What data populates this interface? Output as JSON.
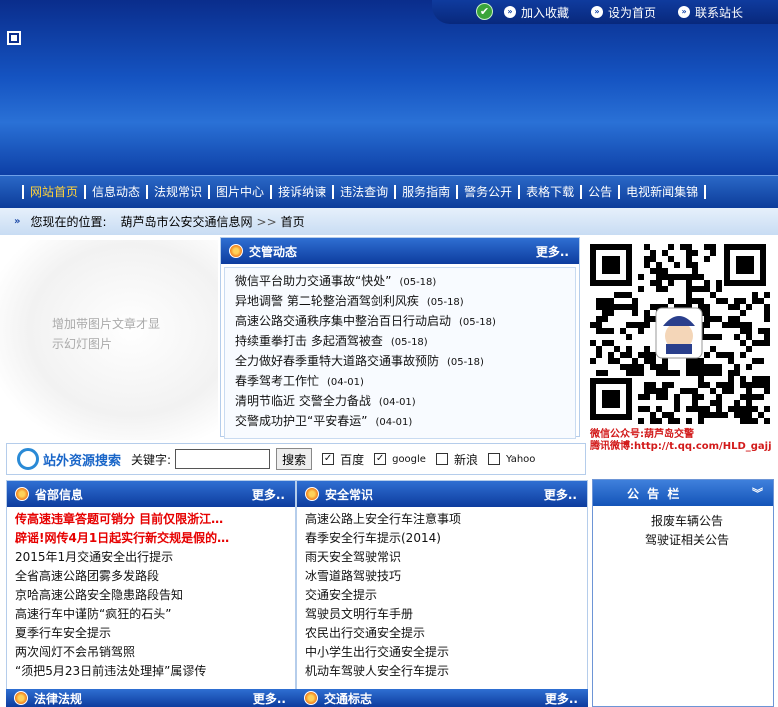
{
  "top_links": {
    "favorite": "加入收藏",
    "homepage": "设为首页",
    "contact": "联系站长"
  },
  "nav": [
    "网站首页",
    "信息动态",
    "法规常识",
    "图片中心",
    "接诉纳谏",
    "违法查询",
    "服务指南",
    "警务公开",
    "表格下载",
    "公告",
    "电视新闻集锦"
  ],
  "breadcrumb": {
    "label": "您现在的位置:",
    "site": "葫芦岛市公安交通信息网",
    "sep": ">>",
    "current": "首页"
  },
  "slideshow": {
    "placeholder": "增加带图片文章才显示幻灯图片"
  },
  "news": {
    "title": "交管动态",
    "more": "更多..",
    "items": [
      {
        "text": "微信平台助力交通事故“快处”",
        "date": "(05-18)"
      },
      {
        "text": "异地调警 第二轮整治酒驾剑利风疾",
        "date": "(05-18)"
      },
      {
        "text": "高速公路交通秩序集中整治百日行动启动",
        "date": "(05-18)"
      },
      {
        "text": "持续重拳打击 多起酒驾被查",
        "date": "(05-18)"
      },
      {
        "text": "全力做好春季重特大道路交通事故预防",
        "date": "(05-18)"
      },
      {
        "text": "春季驾考工作忙",
        "date": "(04-01)"
      },
      {
        "text": "清明节临近 交警全力备战",
        "date": "(04-01)"
      },
      {
        "text": "交警成功护卫“平安春运”",
        "date": "(04-01)"
      }
    ]
  },
  "qr": {
    "wechat": "微信公众号:葫芦岛交警",
    "weibo": "腾讯微博:http://t.qq.com/HLD_gajj"
  },
  "search": {
    "logo": "站外资源搜索",
    "keyword_label": "关键字:",
    "button": "搜索",
    "engines": [
      "百度",
      "google",
      "新浪",
      "Yahoo"
    ],
    "checked": [
      true,
      true,
      false,
      false
    ]
  },
  "province": {
    "title": "省部信息",
    "more": "更多..",
    "items": [
      {
        "text": "传高速违章答题可销分 目前仅限浙江…",
        "hot": true
      },
      {
        "text": "辟谣!网传4月1日起实行新交规是假的…",
        "hot": true
      },
      {
        "text": "2015年1月交通安全出行提示",
        "hot": false
      },
      {
        "text": "全省高速公路团雾多发路段",
        "hot": false
      },
      {
        "text": "京哈高速公路安全隐患路段告知",
        "hot": false
      },
      {
        "text": "高速行车中谨防“疯狂的石头”",
        "hot": false
      },
      {
        "text": "夏季行车安全提示",
        "hot": false
      },
      {
        "text": "两次闯灯不会吊销驾照",
        "hot": false
      },
      {
        "text": "“须把5月23日前违法处理掉”属谬传",
        "hot": false
      }
    ]
  },
  "safety": {
    "title": "安全常识",
    "more": "更多..",
    "items": [
      "高速公路上安全行车注意事项",
      "春季安全行车提示(2014)",
      "雨天安全驾驶常识",
      "冰雪道路驾驶技巧",
      "交通安全提示",
      "驾驶员文明行车手册",
      "农民出行交通安全提示",
      "中小学生出行交通安全提示",
      "机动车驾驶人安全行车提示"
    ]
  },
  "notice": {
    "title": "公 告 栏",
    "items": [
      "报废车辆公告",
      "驾驶证相关公告"
    ]
  },
  "bottom": {
    "law": "法律法规",
    "law_more": "更多..",
    "sign": "交通标志",
    "sign_more": "更多.."
  },
  "colors": {
    "banner": "#1554c2",
    "nav_active": "#ffd23a",
    "hot": "#e60000"
  }
}
